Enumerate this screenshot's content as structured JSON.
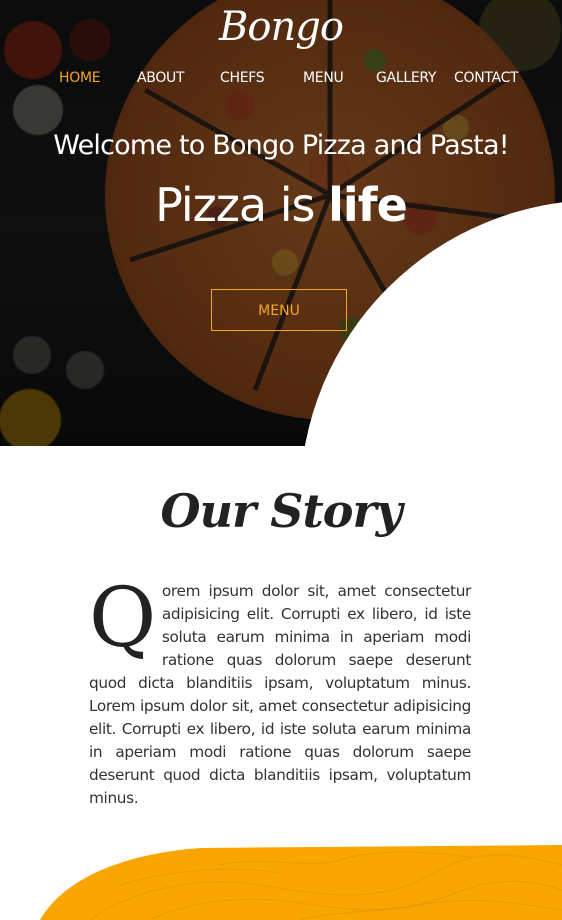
{
  "brand": {
    "logo_text": "Bongo"
  },
  "nav": {
    "items": [
      {
        "label": "HOME",
        "active": true
      },
      {
        "label": "ABOUT",
        "active": false
      },
      {
        "label": "CHEFS",
        "active": false
      },
      {
        "label": "MENU",
        "active": false
      },
      {
        "label": "GALLERY",
        "active": false
      },
      {
        "label": "CONTACT",
        "active": false
      }
    ]
  },
  "hero": {
    "welcome": "Welcome to Bongo Pizza and Pasta!",
    "tagline_light": "Pizza is ",
    "tagline_bold": "life",
    "button_label": "MENU"
  },
  "story": {
    "title": "Our Story",
    "drop_cap": "Q",
    "body": "orem ipsum dolor sit, amet consectetur adipisicing elit. Corrupti ex libero, id iste soluta earum minima in aperiam modi ratione quas dolorum saepe deserunt quod dicta blanditiis ipsam, voluptatum minus. Lorem ipsum dolor sit, amet consectetur adipisicing elit. Corrupti ex libero, id iste soluta earum minima in aperiam modi ratione quas dolorum saepe deserunt quod dicta blanditiis ipsam, voluptatum minus."
  },
  "colors": {
    "accent": "#f5a623",
    "hero_overlay": "#141414",
    "text_dark": "#222222",
    "wave_orange": "#f9a602"
  }
}
